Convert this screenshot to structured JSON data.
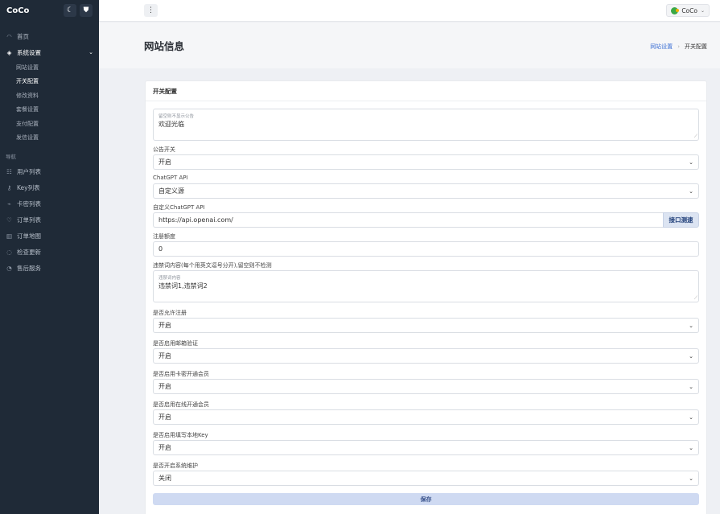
{
  "brand": {
    "name": "CoCo",
    "theme_icon": "moon-icon",
    "shield_icon": "shield-icon"
  },
  "sidebar": {
    "home": "首页",
    "system": "系统设置",
    "sub_items": [
      "网站设置",
      "开关配置",
      "修改资料",
      "套餐设置",
      "支付配置",
      "发信设置"
    ],
    "nav_label": "导航",
    "nav_items": [
      "用户列表",
      "Key列表",
      "卡密列表",
      "订单列表",
      "订单地图",
      "检查更新",
      "售后服务"
    ]
  },
  "topbar": {
    "menu_icon": "more-vertical-icon",
    "user_name": "CoCo"
  },
  "page": {
    "title": "网站信息"
  },
  "breadcrumb": {
    "parent": "网站设置",
    "current": "开关配置"
  },
  "card": {
    "header": "开关配置",
    "notice": {
      "placeholder": "留空则不显示公告",
      "value": "欢迎光临"
    },
    "notice_switch": {
      "label": "公告开关",
      "value": "开启"
    },
    "chatgpt_api": {
      "label": "ChatGPT API",
      "value": "自定义源"
    },
    "custom_api": {
      "label": "自定义ChatGPT API",
      "value": "https://api.openai.com/",
      "button": "接口测速"
    },
    "register_quota": {
      "label": "注册额度",
      "value": "0"
    },
    "banned_words": {
      "label": "违禁词内容(每个用英文逗号分开),留空则不检测",
      "placeholder": "违禁词内容",
      "value": "违禁词1,违禁词2"
    },
    "allow_register": {
      "label": "是否允许注册",
      "value": "开启"
    },
    "email_verify": {
      "label": "是否启用邮箱验证",
      "value": "开启"
    },
    "card_member": {
      "label": "是否启用卡密开通会员",
      "value": "开启"
    },
    "online_member": {
      "label": "是否启用在线开通会员",
      "value": "开启"
    },
    "local_key": {
      "label": "是否启用填写本地Key",
      "value": "开启"
    },
    "maintenance": {
      "label": "是否开启系统维护",
      "value": "关闭"
    },
    "save": "保存"
  }
}
